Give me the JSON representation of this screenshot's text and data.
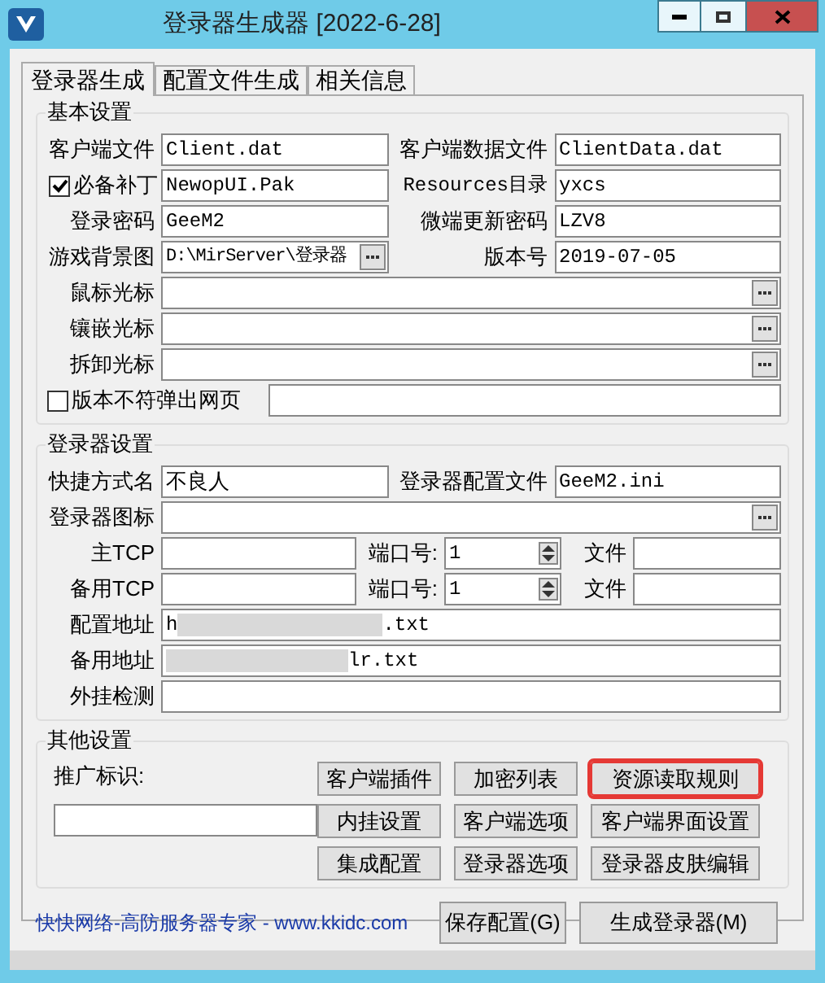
{
  "window": {
    "title": "登录器生成器 [2022-6-28]"
  },
  "tabs": [
    {
      "label": "登录器生成",
      "selected": true
    },
    {
      "label": "配置文件生成",
      "selected": false
    },
    {
      "label": "相关信息",
      "selected": false
    }
  ],
  "basic_settings": {
    "title": "基本设置",
    "client_file": {
      "label": "客户端文件",
      "value": "Client.dat"
    },
    "client_data_file": {
      "label": "客户端数据文件",
      "value": "ClientData.dat"
    },
    "required_patch": {
      "label": "必备补丁",
      "checked": true,
      "value": "NewopUI.Pak"
    },
    "resources_dir": {
      "label": "Resources目录",
      "value": "yxcs"
    },
    "login_password": {
      "label": "登录密码",
      "value": "GeeM2"
    },
    "micro_update_password": {
      "label": "微端更新密码",
      "value": "LZV8"
    },
    "background": {
      "label": "游戏背景图",
      "value": "D:\\MirServer\\登录器"
    },
    "version": {
      "label": "版本号",
      "value": "2019-07-05"
    },
    "cursors": [
      {
        "label": "鼠标光标"
      },
      {
        "label": "镶嵌光标"
      },
      {
        "label": "拆卸光标"
      }
    ],
    "popup_on_mismatch": {
      "label": "版本不符弹出网页",
      "checked": false
    }
  },
  "launcher_settings": {
    "title": "登录器设置",
    "shortcut_name": {
      "label": "快捷方式名",
      "value": "不良人"
    },
    "config_file": {
      "label": "登录器配置文件",
      "value": "GeeM2.ini"
    },
    "icon": {
      "label": "登录器图标"
    },
    "servers": [
      {
        "label": "主TCP",
        "port_label": "端口号:",
        "port": "1",
        "file_label": "文件"
      },
      {
        "label": "备用TCP",
        "port_label": "端口号:",
        "port": "1",
        "file_label": "文件"
      }
    ],
    "config_url": {
      "label": "配置地址",
      "value_start": "h",
      "value_end": ".txt"
    },
    "backup_url": {
      "label": "备用地址",
      "value_end": "lr.txt"
    },
    "plugin_check": {
      "label": "外挂检测"
    }
  },
  "other_settings": {
    "title": "其他设置",
    "promo_label": "推广标识:",
    "buttons": [
      {
        "label": "客户端插件",
        "highlighted": false
      },
      {
        "label": "加密列表",
        "highlighted": false
      },
      {
        "label": "资源读取规则",
        "highlighted": true
      },
      {
        "label": "内挂设置",
        "highlighted": false
      },
      {
        "label": "客户端选项",
        "highlighted": false
      },
      {
        "label": "客户端界面设置",
        "highlighted": false
      },
      {
        "label": "集成配置",
        "highlighted": false
      },
      {
        "label": "登录器选项",
        "highlighted": false
      },
      {
        "label": "登录器皮肤编辑",
        "highlighted": false
      }
    ]
  },
  "footer": {
    "link": "快快网络-高防服务器专家 - www.kkidc.com",
    "buttons": [
      "保存配置(G)",
      "生成登录器(M)"
    ]
  }
}
